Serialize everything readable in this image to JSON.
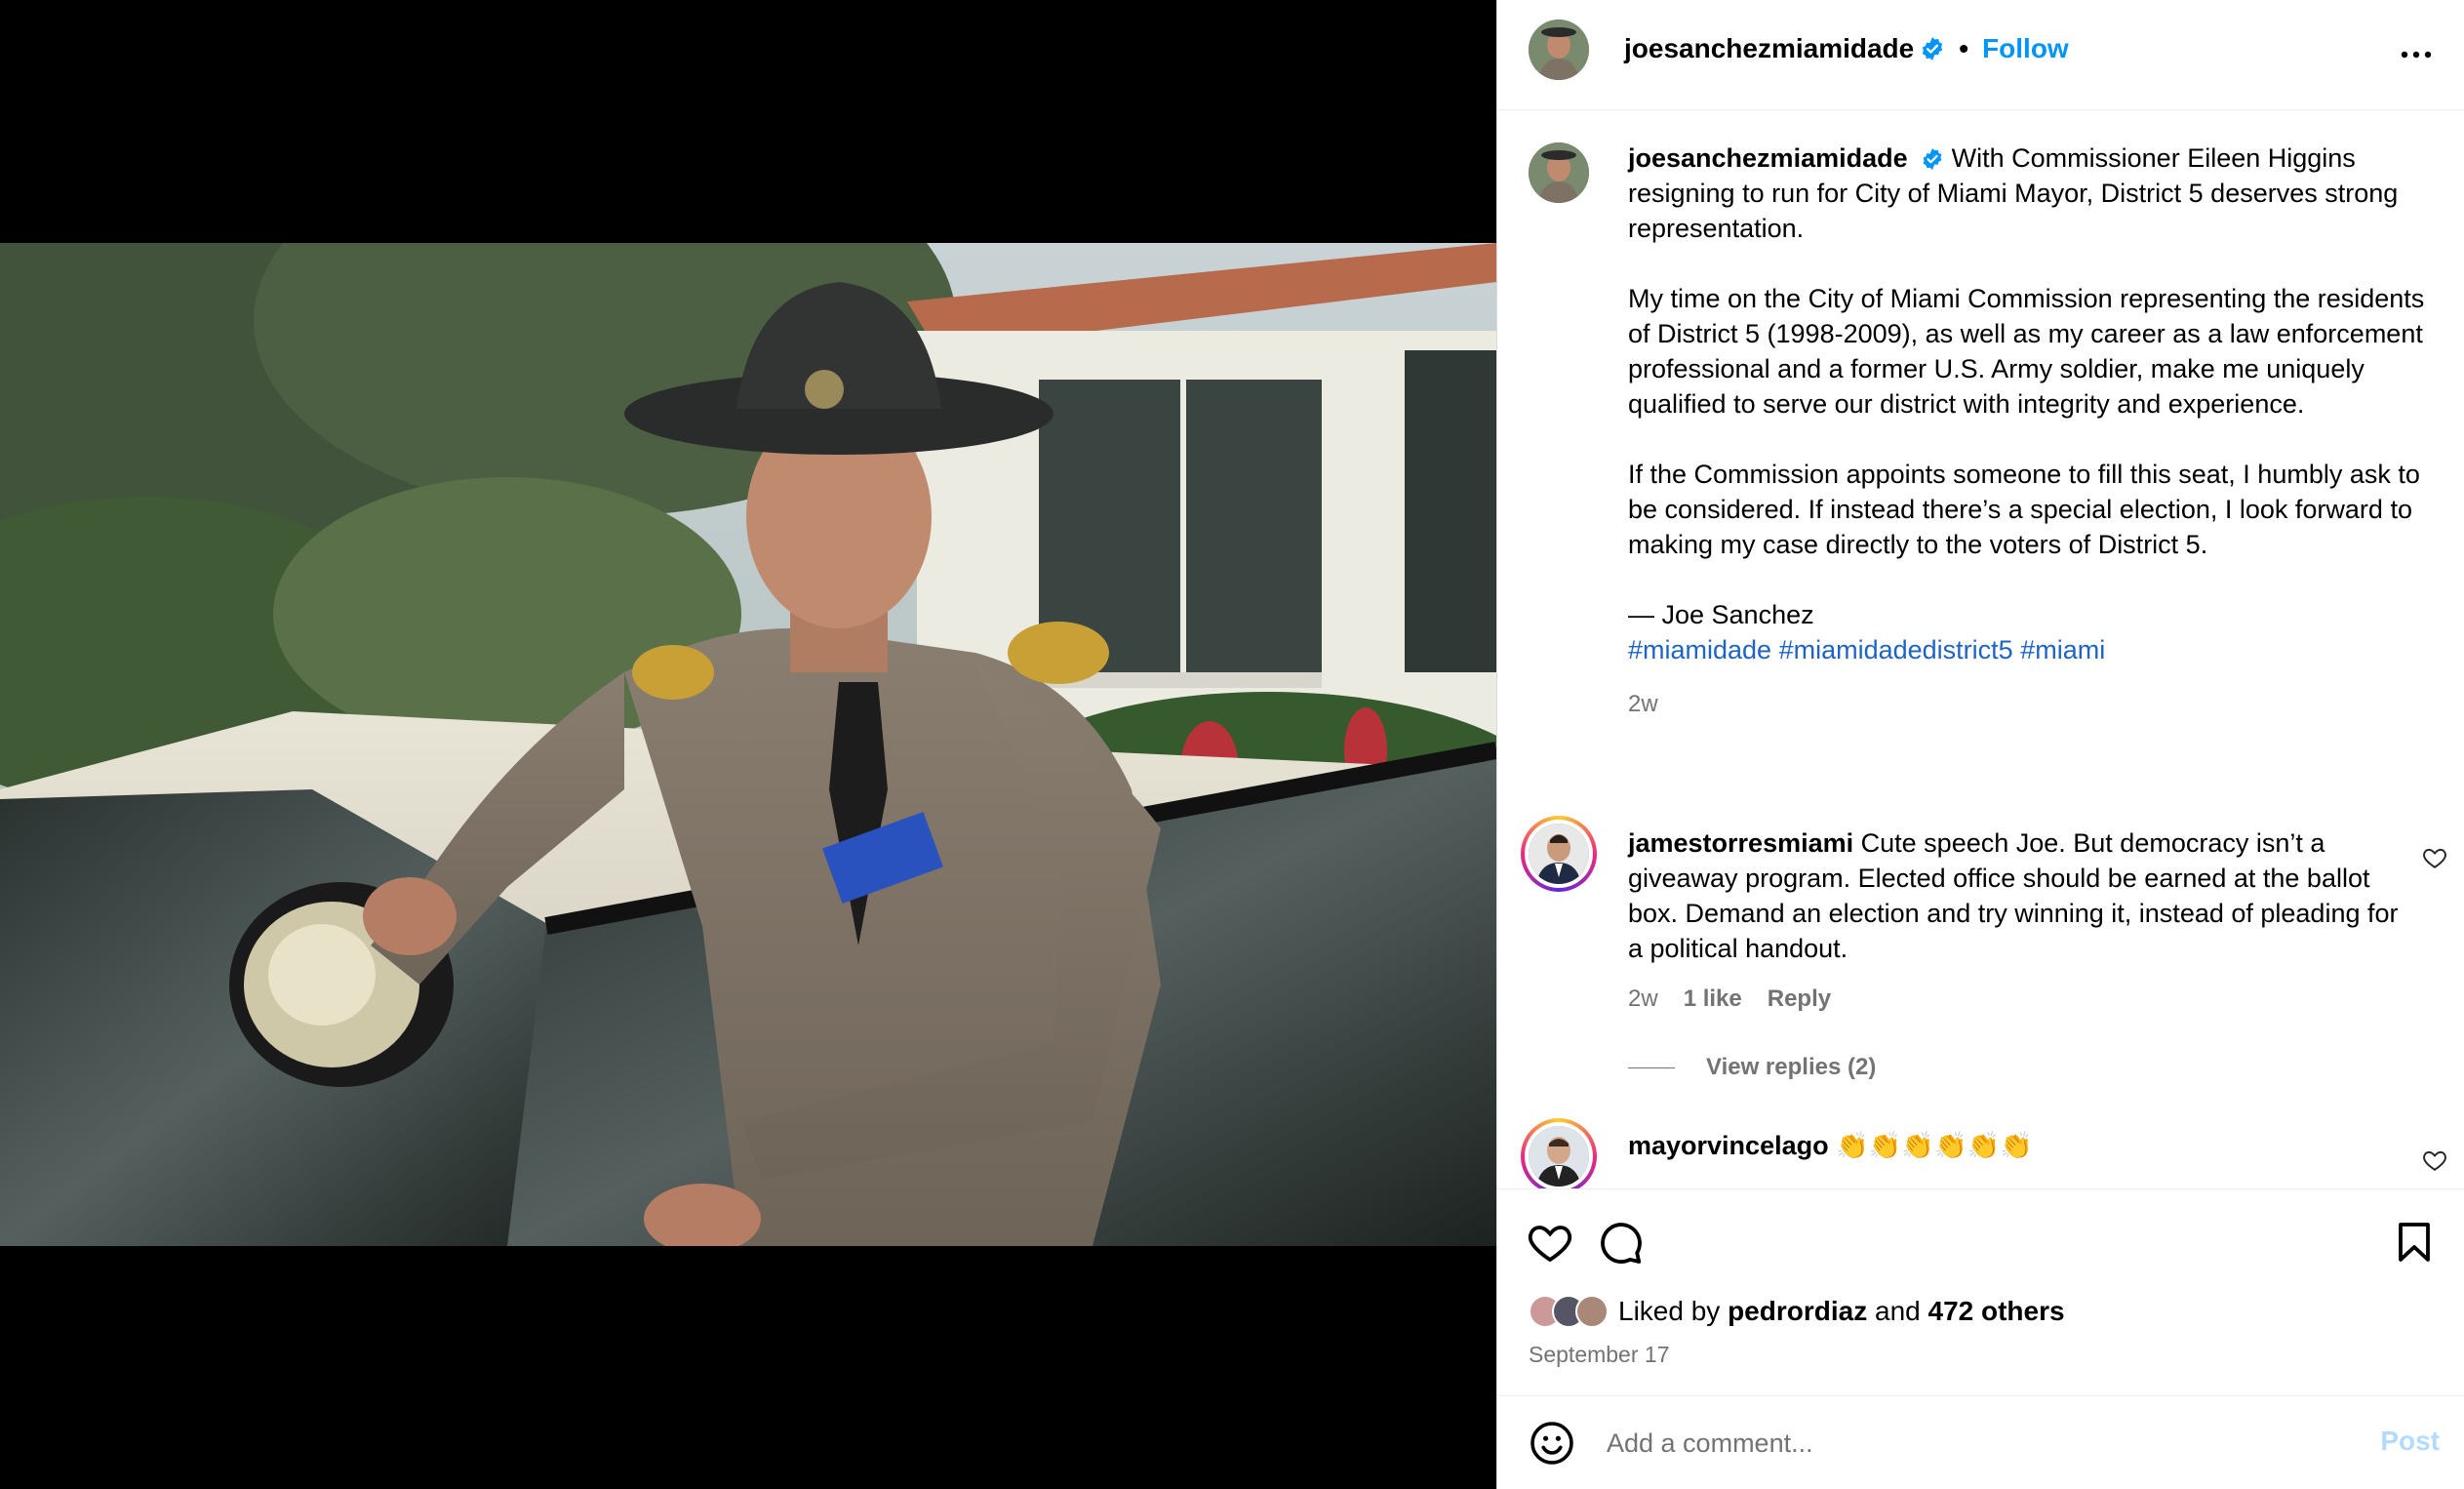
{
  "author": {
    "username": "joesanchezmiamidade",
    "follow_label": "Follow",
    "separator": "•"
  },
  "caption": {
    "username": "joesanchezmiamidade",
    "para1": "With Commissioner Eileen Higgins resigning to run for City of Miami Mayor, District 5 deserves strong representation.",
    "para2": "My time on the City of Miami Commission representing the residents of District 5 (1998-2009), as well as my career as a law enforcement professional and a former U.S. Army soldier, make me uniquely qualified to serve our district with integrity and experience.",
    "para3": "If the Commission appoints someone to fill this seat, I humbly ask to be considered. If instead there’s a special election, I look forward to making my case directly to the voters of District 5.",
    "signature": "— Joe Sanchez",
    "hashtags": [
      "#miamidade",
      "#miamidadedistrict5",
      "#miami"
    ],
    "age": "2w"
  },
  "comments": [
    {
      "username": "jamestorresmiami",
      "text": "Cute speech Joe. But democracy isn’t a giveaway program. Elected office should be earned at the ballot box. Demand an election and try winning it, instead of pleading for a political handout.",
      "age": "2w",
      "likes": "1 like",
      "reply_label": "Reply",
      "view_replies": "View replies (2)"
    },
    {
      "username": "mayorvincelago",
      "text": "👏👏👏👏👏👏"
    }
  ],
  "engagement": {
    "liked_by_prefix": "Liked by",
    "liked_by_user": "pedrordiaz",
    "liked_by_and": "and",
    "others": "472 others",
    "date": "September 17"
  },
  "composer": {
    "placeholder": "Add a comment...",
    "post_label": "Post"
  },
  "icons": {
    "verified": "verified-badge-icon",
    "more": "more-options-icon",
    "like": "heart-icon",
    "comment": "comment-bubble-icon",
    "save": "bookmark-icon",
    "emoji": "emoji-icon"
  },
  "colors": {
    "link_blue": "#0095f6",
    "hashtag_blue": "#1d63c8",
    "muted_gray": "#737373",
    "post_disabled": "#b3dbff"
  }
}
